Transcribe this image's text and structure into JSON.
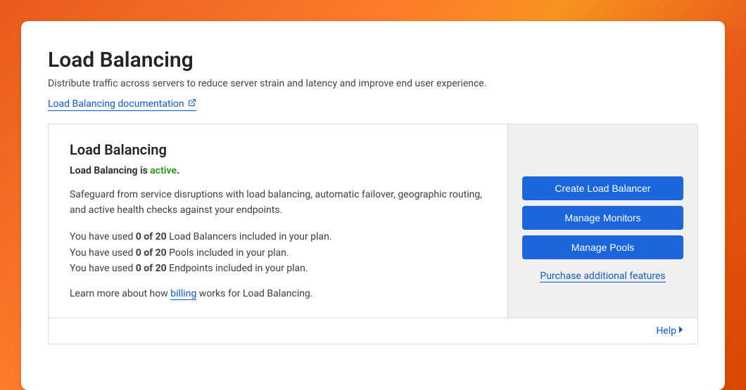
{
  "header": {
    "title": "Load Balancing",
    "subtitle": "Distribute traffic across servers to reduce server strain and latency and improve end user experience.",
    "doc_link_label": "Load Balancing documentation"
  },
  "panel": {
    "title": "Load Balancing",
    "status_prefix": "Load Balancing is ",
    "status_value": "active",
    "status_suffix": ".",
    "description": "Safeguard from service disruptions with load balancing, automatic failover, geographic routing, and active health checks against your endpoints.",
    "usage": {
      "lb": {
        "prefix": "You have used ",
        "count": "0 of 20",
        "suffix": " Load Balancers included in your plan."
      },
      "pools": {
        "prefix": "You have used ",
        "count": "0 of 20",
        "suffix": " Pools included in your plan."
      },
      "endpoints": {
        "prefix": "You have used ",
        "count": "0 of 20",
        "suffix": " Endpoints included in your plan."
      }
    },
    "billing_prefix": "Learn more about how ",
    "billing_link": "billing",
    "billing_suffix": " works for Load Balancing."
  },
  "actions": {
    "create": "Create Load Balancer",
    "manage_monitors": "Manage Monitors",
    "manage_pools": "Manage Pools",
    "purchase": "Purchase additional features"
  },
  "footer": {
    "help": "Help"
  }
}
